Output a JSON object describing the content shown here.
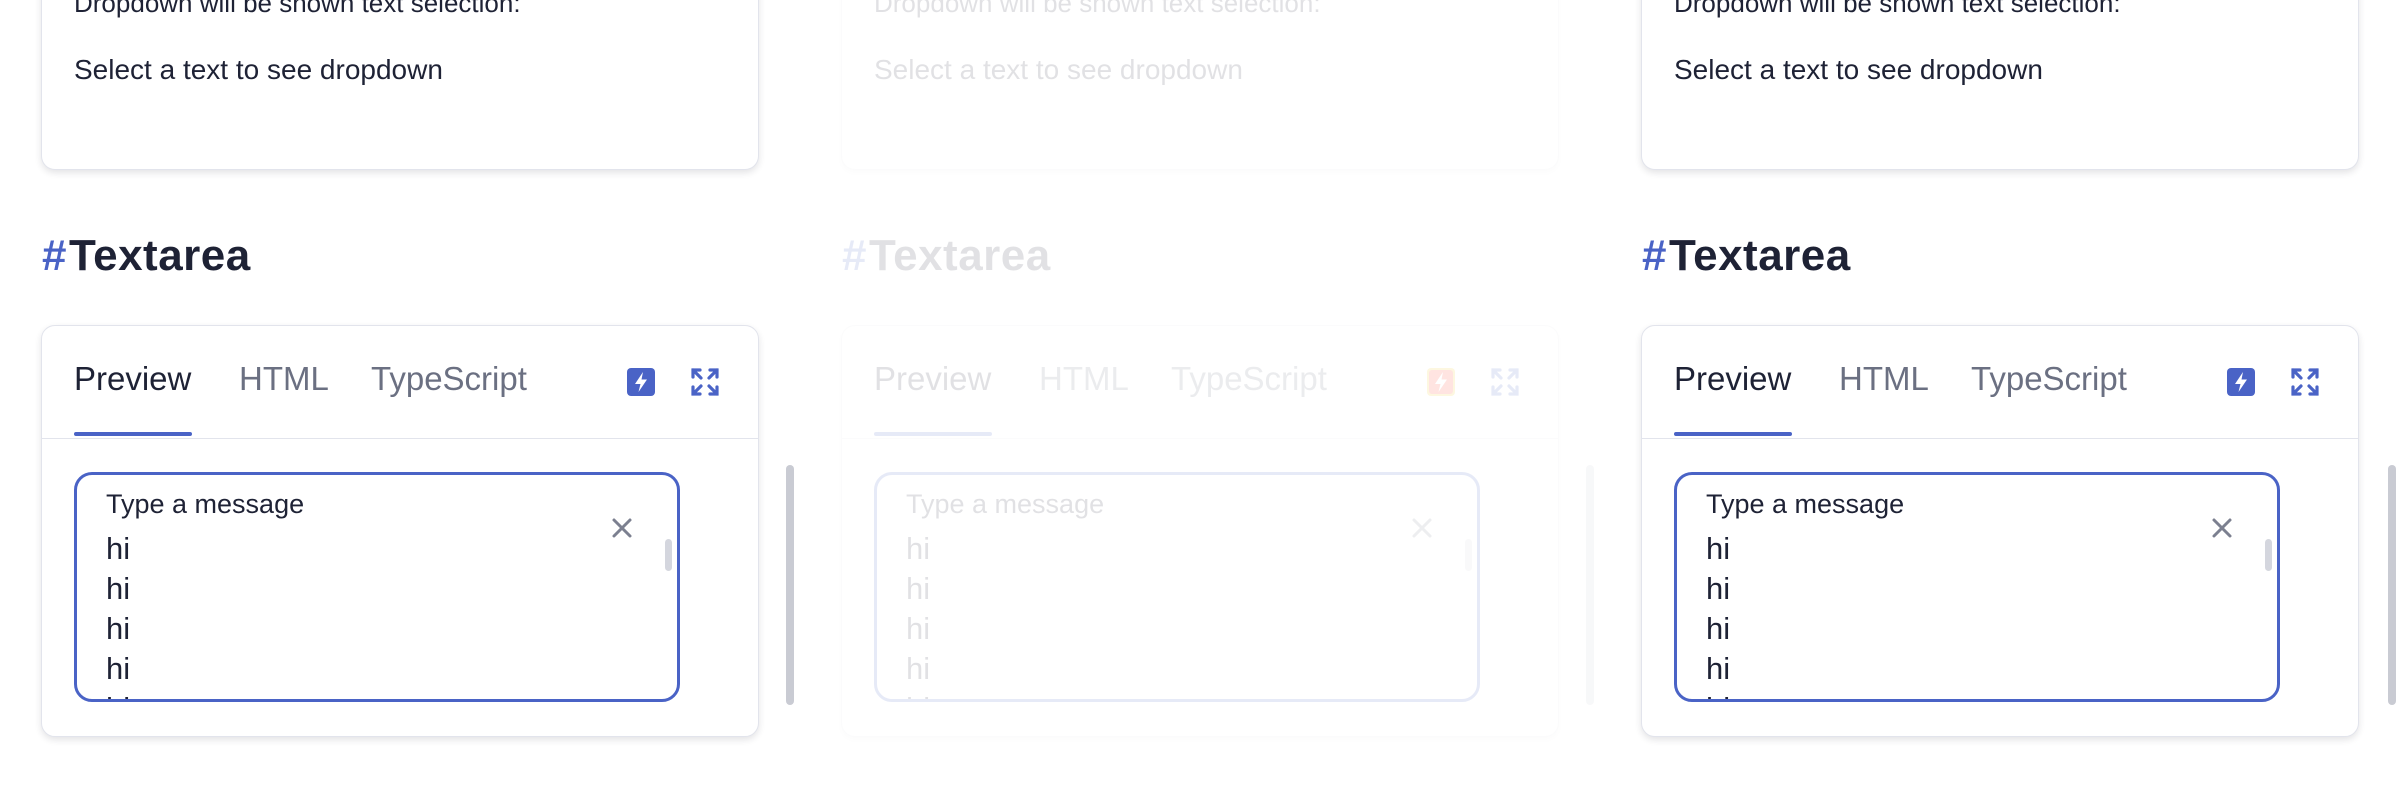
{
  "panels": [
    {
      "dropdown_card": {
        "line1": "Dropdown will be shown text selection:",
        "line2": "Select a text to see dropdown"
      },
      "section": {
        "hash": "#",
        "title": "Textarea"
      },
      "tabs": [
        {
          "label": "Preview",
          "active": true
        },
        {
          "label": "HTML",
          "active": false
        },
        {
          "label": "TypeScript",
          "active": false
        }
      ],
      "icons": {
        "bolt": "bolt-icon",
        "expand": "expand-icon",
        "clear": "close-icon"
      },
      "textarea": {
        "label": "Type a message",
        "lines": [
          "hi",
          "hi",
          "hi",
          "hi",
          "hi"
        ]
      }
    },
    {
      "dropdown_card": {
        "line1": "Dropdown will be shown text selection:",
        "line2": "Select a text to see dropdown"
      },
      "section": {
        "hash": "#",
        "title": "Textarea"
      },
      "tabs": [
        {
          "label": "Preview",
          "active": true
        },
        {
          "label": "HTML",
          "active": false
        },
        {
          "label": "TypeScript",
          "active": false
        }
      ],
      "icons": {
        "bolt": "bolt-icon",
        "expand": "expand-icon",
        "clear": "close-icon"
      },
      "textarea": {
        "label": "Type a message",
        "lines": [
          "hi",
          "hi",
          "hi",
          "hi",
          "hi"
        ]
      }
    },
    {
      "dropdown_card": {
        "line1": "Dropdown will be shown text selection:",
        "line2": "Select a text to see dropdown"
      },
      "section": {
        "hash": "#",
        "title": "Textarea"
      },
      "tabs": [
        {
          "label": "Preview",
          "active": true
        },
        {
          "label": "HTML",
          "active": false
        },
        {
          "label": "TypeScript",
          "active": false
        }
      ],
      "icons": {
        "bolt": "bolt-icon",
        "expand": "expand-icon",
        "clear": "close-icon"
      },
      "textarea": {
        "label": "Type a message",
        "lines": [
          "hi",
          "hi",
          "hi",
          "hi",
          "hi"
        ]
      }
    }
  ],
  "colors": {
    "accent": "#4a63c6",
    "text": "#1e2235",
    "muted": "#6b7082",
    "border": "#e2e4ec",
    "highlight": "#f5c518"
  }
}
